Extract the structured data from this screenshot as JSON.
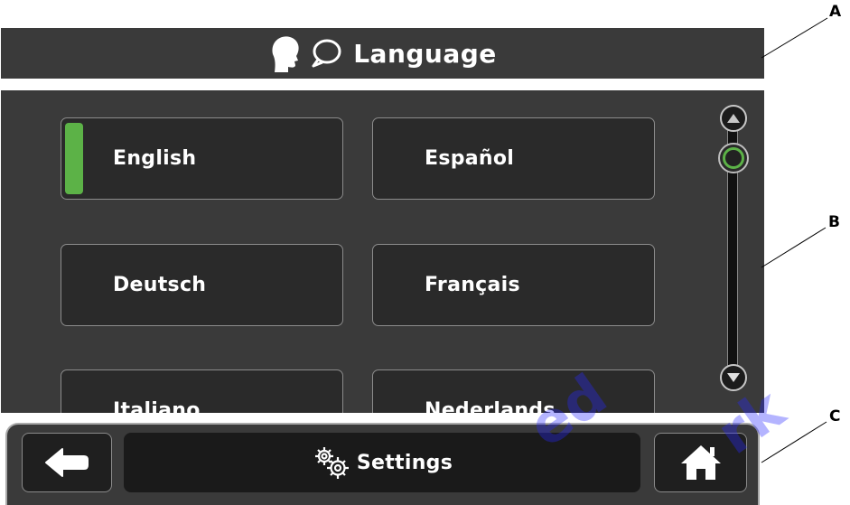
{
  "header": {
    "title": "Language"
  },
  "languages": [
    {
      "label": "English",
      "selected": true
    },
    {
      "label": "Español",
      "selected": false
    },
    {
      "label": "Deutsch",
      "selected": false
    },
    {
      "label": "Français",
      "selected": false
    },
    {
      "label": "Italiano",
      "selected": false
    },
    {
      "label": "Nederlands",
      "selected": false
    }
  ],
  "footer": {
    "settings_label": "Settings"
  },
  "callouts": {
    "a": "A",
    "b": "B",
    "c": "C"
  },
  "watermark": {
    "text_1": "ed",
    "text_2": "rk"
  },
  "colors": {
    "panel": "#3a3a3a",
    "selection_accent": "#5cb247",
    "button_bg": "#2a2a2a"
  }
}
